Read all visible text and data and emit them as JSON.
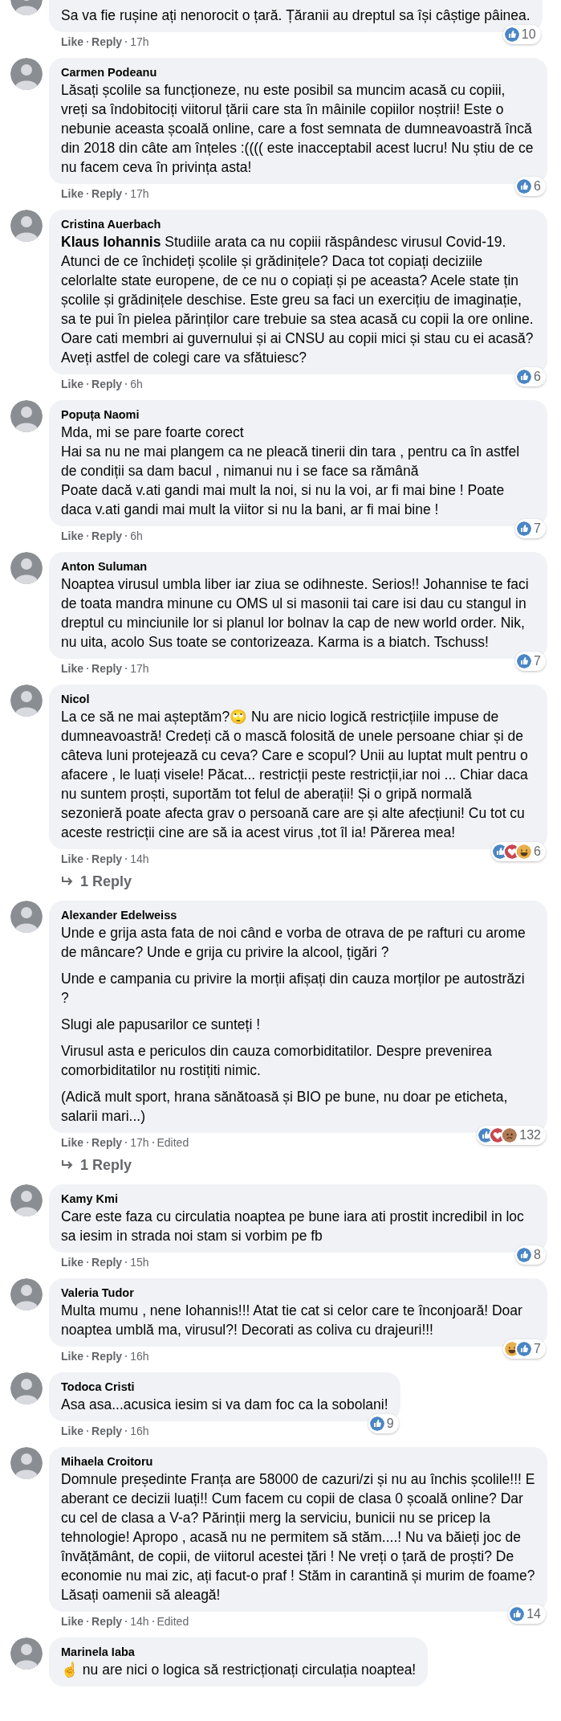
{
  "comments": [
    {
      "paragraphs": [
        "Sa va fie rușine ați nenorocit o țară. Țăranii au dreptul sa își câștige pâinea."
      ],
      "like": "Like",
      "reply": "Reply",
      "time": "17h",
      "reactions": {
        "icons": [
          {
            "kind": "like"
          }
        ],
        "count": "10"
      }
    },
    {
      "author": "Carmen Podeanu",
      "paragraphs": [
        "Lăsați școlile sa funcționeze, nu este posibil sa muncim acasă cu copiii, vreți sa îndobitociți viitorul țării care sta în mâinile copiilor noștrii! Este o nebunie aceasta școală online, care a fost semnata de dumneavoastră încă din 2018 din câte am înțeles :(((( este inacceptabil acest lucru! Nu știu de ce nu facem ceva în privința asta!"
      ],
      "like": "Like",
      "reply": "Reply",
      "time": "17h",
      "reactions": {
        "icons": [
          {
            "kind": "like"
          }
        ],
        "count": "6"
      }
    },
    {
      "author": "Cristina Auerbach",
      "paragraphs": [
        "**Klaus Iohannis** Studiile arata ca nu copiii răspândesc virusul Covid-19. Atunci de ce închideți școlile și grădinițele? Daca tot copiați deciziile celorlalte state europene, de ce nu o copiați și pe aceasta? Acele state țin școlile și grădinițele deschise. Este greu sa faci un exercițiu de imaginație, sa te pui în pielea părinților care trebuie sa stea acasă cu copii la ore online. Oare cati membri ai guvernului și ai CNSU au copii mici și stau cu ei acasă? Aveți astfel de colegi care va sfătuiesc?"
      ],
      "like": "Like",
      "reply": "Reply",
      "time": "6h",
      "reactions": {
        "icons": [
          {
            "kind": "like"
          }
        ],
        "count": "6"
      }
    },
    {
      "author": "Popuța Naomi",
      "paragraphs": [
        "Mda, mi se pare foarte corect\nHai sa nu ne mai plangem ca ne pleacă tinerii din tara , pentru ca în astfel de condiții sa dam bacul , nimanui nu i se face sa rămână\nPoate dacă v.ati gandi mai mult la noi, si nu la voi, ar fi mai bine ! Poate daca v.ati gandi mai mult la viitor si nu la bani, ar fi mai bine !"
      ],
      "like": "Like",
      "reply": "Reply",
      "time": "6h",
      "reactions": {
        "icons": [
          {
            "kind": "like"
          }
        ],
        "count": "7"
      }
    },
    {
      "author": "Anton Suluman",
      "paragraphs": [
        "Noaptea virusul umbla liber iar ziua se odihneste. Serios!! Johannise te faci de toata mandra minune cu OMS ul si masonii tai care isi dau cu stangul in dreptul cu minciunile lor si planul lor bolnav la cap de new world order. Nik, nu uita, acolo Sus toate se contorizeaza. Karma is a biatch. Tschuss!"
      ],
      "like": "Like",
      "reply": "Reply",
      "time": "17h",
      "reactions": {
        "icons": [
          {
            "kind": "like"
          }
        ],
        "count": "7"
      }
    },
    {
      "author": "Nicol",
      "paragraphs": [
        "La ce să ne mai așteptăm?🙄 Nu are nicio logică restricțiile impuse de dumneavoastră! Credeți că o mască folosită de unele persoane chiar și de câteva luni protejează cu ceva? Care e scopul? Unii au luptat mult pentru o afacere , le luați visele! Păcat... restricții peste restricții,iar noi ... Chiar daca nu suntem proști, suportăm tot felul de aberații! Și o gripă normală sezonieră poate afecta grav o persoană care are și alte afecțiuni! Cu tot cu aceste restricții cine are să ia acest virus ,tot îl ia! Părerea mea!"
      ],
      "like": "Like",
      "reply": "Reply",
      "time": "14h",
      "reactions": {
        "icons": [
          {
            "kind": "like"
          },
          {
            "kind": "love"
          },
          {
            "kind": "haha"
          }
        ],
        "count": "6"
      },
      "replies": "1 Reply"
    },
    {
      "author": "Alexander Edelweiss",
      "paragraphs": [
        "Unde e grija asta fata de noi când e vorba de otrava de pe rafturi cu arome de mâncare? Unde e grija cu privire la alcool, țigări ?",
        "Unde e campania cu privire la morții afișați din cauza morților pe autostrăzi ?",
        "Slugi ale papusarilor ce sunteți !",
        "Virusul asta e periculos din cauza comorbiditatilor. Despre prevenirea comorbiditatilor nu rostițiti nimic.",
        "(Adică mult sport, hrana sănătoasă și BIO pe bune, nu doar pe eticheta, salarii mari...)"
      ],
      "like": "Like",
      "reply": "Reply",
      "time": "17h",
      "edited": "Edited",
      "reactions": {
        "icons": [
          {
            "kind": "like"
          },
          {
            "kind": "love"
          },
          {
            "kind": "sad"
          }
        ],
        "count": "132"
      },
      "replies": "1 Reply"
    },
    {
      "author": "Kamy Kmi",
      "paragraphs": [
        "Care este faza cu circulatia noaptea pe bune iara ati prostit incredibil in loc sa iesim in strada noi stam si vorbim pe fb"
      ],
      "like": "Like",
      "reply": "Reply",
      "time": "15h",
      "reactions": {
        "icons": [
          {
            "kind": "like"
          }
        ],
        "count": "8"
      }
    },
    {
      "author": "Valeria Tudor",
      "paragraphs": [
        "Multa mumu , nene Iohannis!!! Atat tie cat si celor care te înconjoară! Doar noaptea umblă ma, virusul?! Decorati as coliva cu drajeuri!!!"
      ],
      "like": "Like",
      "reply": "Reply",
      "time": "16h",
      "reactions": {
        "icons": [
          {
            "kind": "haha"
          },
          {
            "kind": "like"
          }
        ],
        "count": "7"
      }
    },
    {
      "author": "Todoca Cristi",
      "paragraphs": [
        "Asa asa...acusica iesim si va dam foc ca la sobolani!"
      ],
      "like": "Like",
      "reply": "Reply",
      "time": "16h",
      "reactions": {
        "icons": [
          {
            "kind": "like"
          }
        ],
        "count": "9"
      }
    },
    {
      "author": "Mihaela Croitoru",
      "paragraphs": [
        "Domnule președinte Franța are 58000 de cazuri/zi și nu au închis școlile!!! E aberant ce decizii luați!! Cum facem cu copii de clasa 0 școală online? Dar cu cel de clasa a V-a? Părinții merg la serviciu, bunicii nu se pricep la tehnologie! Apropo , acasă nu ne permitem să stăm....! Nu va băieți joc de învățământ, de copii, de viitorul acestei țări ! Ne vreți o țară de proști? De economie nu mai zic, ați facut-o praf ! Stăm in carantină și murim de foame? Lăsați oamenii să aleagă!"
      ],
      "like": "Like",
      "reply": "Reply",
      "time": "14h",
      "edited": "Edited",
      "reactions": {
        "icons": [
          {
            "kind": "like"
          }
        ],
        "count": "14"
      }
    },
    {
      "author": "Marinela Iaba",
      "paragraphs": [
        "☝ nu are nici o logica să restricționați circulația noaptea!"
      ]
    }
  ]
}
